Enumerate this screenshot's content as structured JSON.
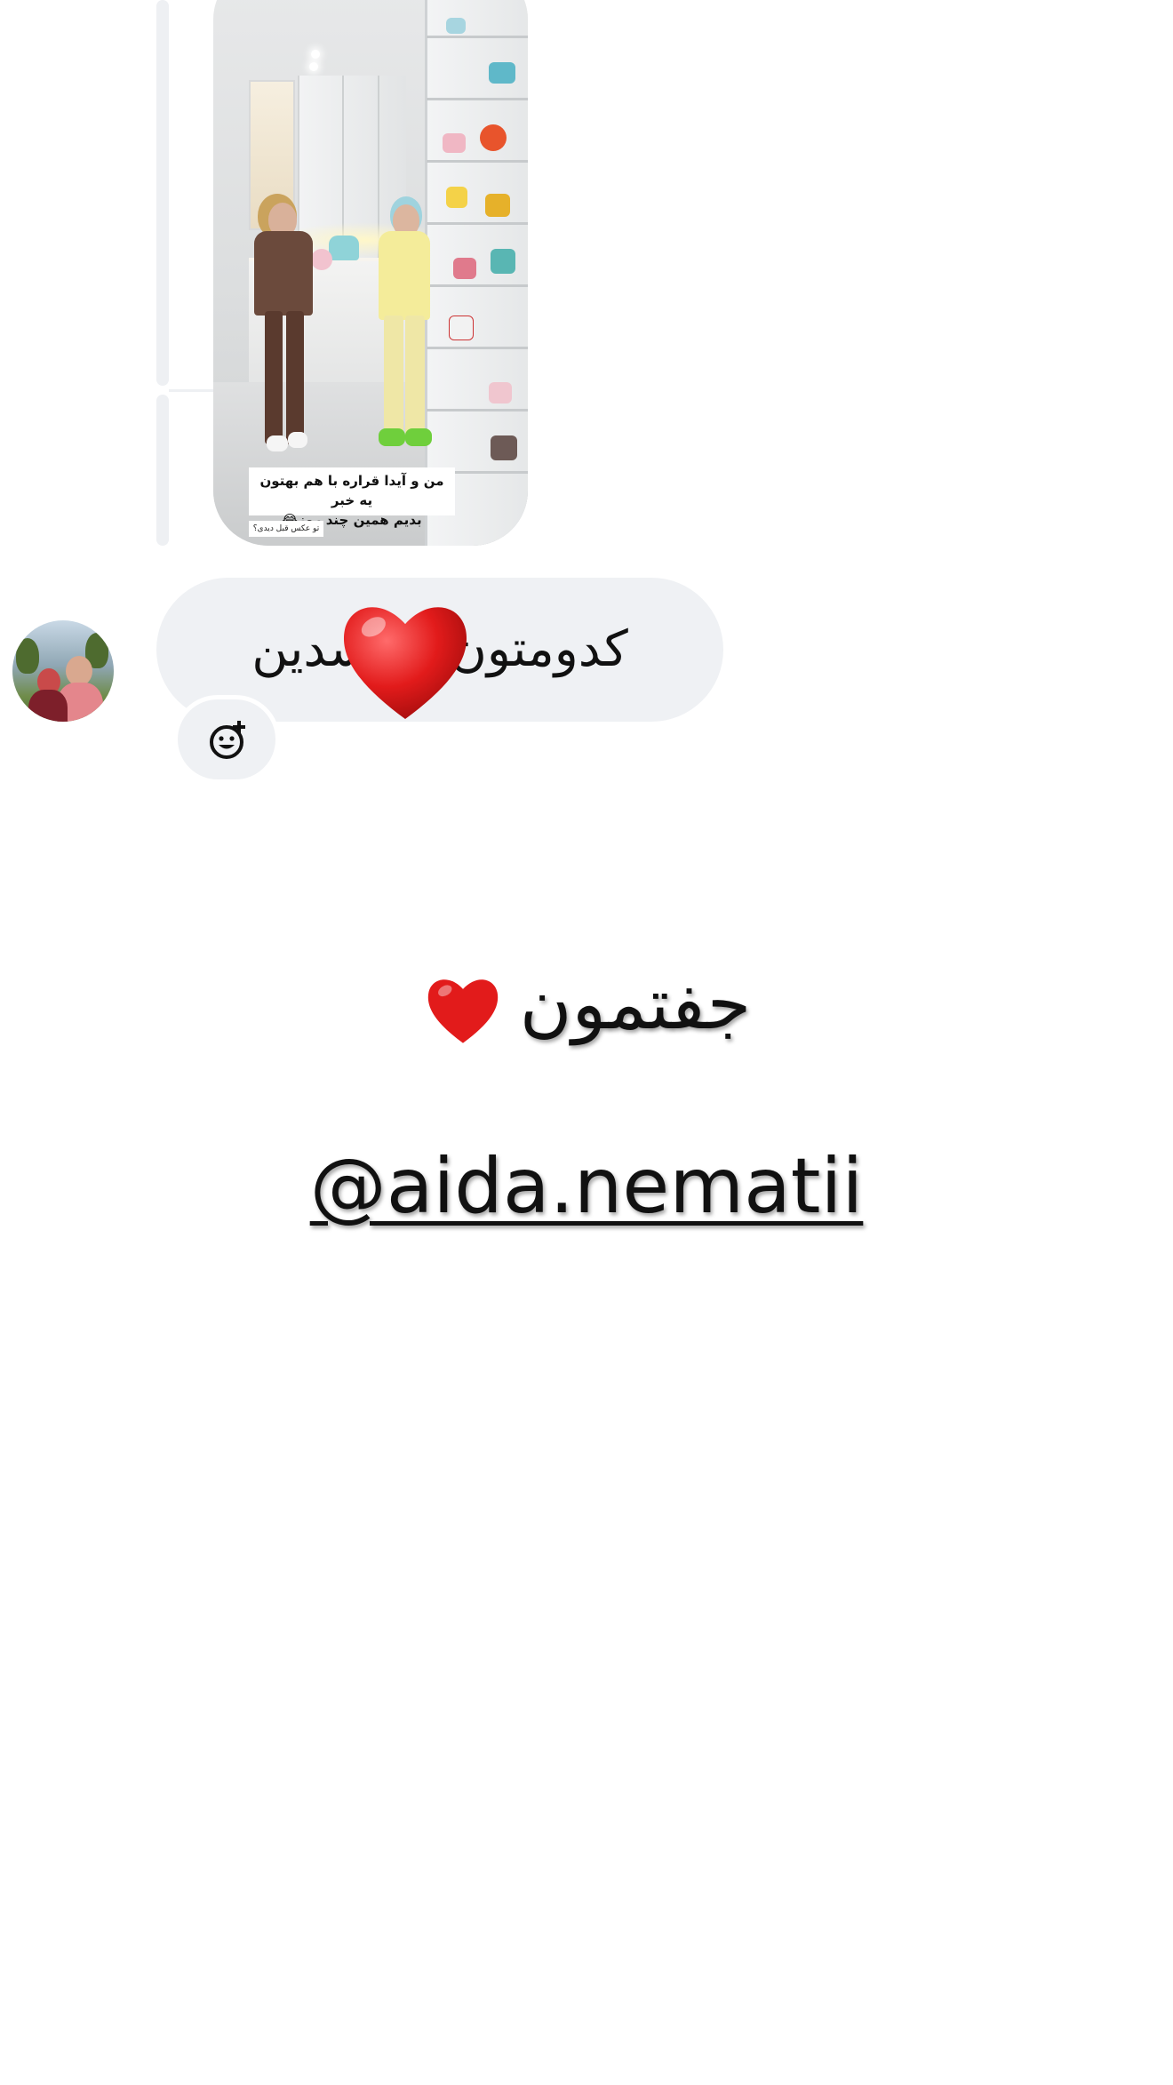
{
  "thread": {
    "story_reply": {
      "caption_line1": "من و آیدا قراره با هم بهتون یه خبر",
      "caption_line2": "بدیم همین چند روز😂",
      "small_tag": "تو عکس قبل دیدی؟"
    },
    "message": {
      "text": "کدومتون ... شدین",
      "reaction": "heart",
      "react_button_icon": "emoji-add-icon"
    }
  },
  "overlay": {
    "title_text": "جفتمون",
    "title_emoji": "heart",
    "handle": "@aida.nematii"
  },
  "colors": {
    "bubble_bg": "#eff1f4",
    "reply_bar": "#eef0f3",
    "heart": "#e21b1b",
    "text": "#111111"
  }
}
